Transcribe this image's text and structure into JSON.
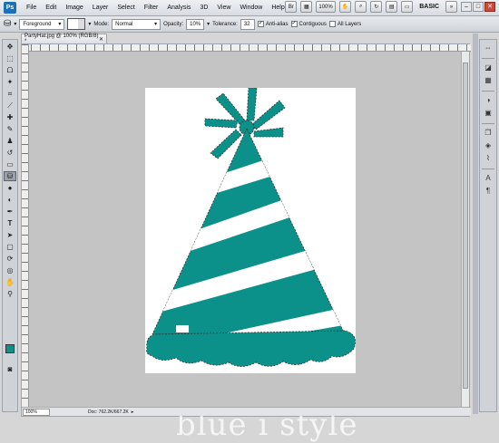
{
  "app": {
    "logo": "Ps"
  },
  "menu": [
    "File",
    "Edit",
    "Image",
    "Layer",
    "Select",
    "Filter",
    "Analysis",
    "3D",
    "View",
    "Window",
    "Help"
  ],
  "menu_right": {
    "zoom": "100%",
    "workspace": "BASIC"
  },
  "options": {
    "fill_source": "Foreground",
    "mode_label": "Mode:",
    "mode_value": "Normal",
    "opacity_label": "Opacity:",
    "opacity_value": "10%",
    "tolerance_label": "Tolerance:",
    "tolerance_value": "32",
    "antialias_label": "Anti-alias",
    "contiguous_label": "Contiguous",
    "all_layers_label": "All Layers"
  },
  "document": {
    "tab_title": "PartyHat.jpg @ 100% (RGB/8) *",
    "zoom": "100%",
    "doc_info": "Doc: 762.2K/667.2K"
  },
  "watermark": "blue i style",
  "colors": {
    "fill": "#0b9189",
    "canvas": "#ffffff",
    "pasteboard": "#c4c4c4"
  },
  "icons": {
    "tools": [
      "move-icon",
      "marquee-icon",
      "lasso-icon",
      "magic-wand-icon",
      "crop-icon",
      "eyedropper-icon",
      "healing-brush-icon",
      "brush-icon",
      "clone-stamp-icon",
      "history-brush-icon",
      "eraser-icon",
      "paint-bucket-icon",
      "blur-icon",
      "dodge-icon",
      "pen-icon",
      "type-icon",
      "path-select-icon",
      "shape-icon",
      "3d-rotate-icon",
      "3d-orbit-icon",
      "hand-icon",
      "zoom-icon"
    ],
    "dock": [
      "arrange-icon",
      "color-icon",
      "swatches-icon",
      "adjustments-icon",
      "masks-icon",
      "layers-icon",
      "channels-icon",
      "paths-icon",
      "character-icon",
      "paragraph-icon"
    ]
  }
}
